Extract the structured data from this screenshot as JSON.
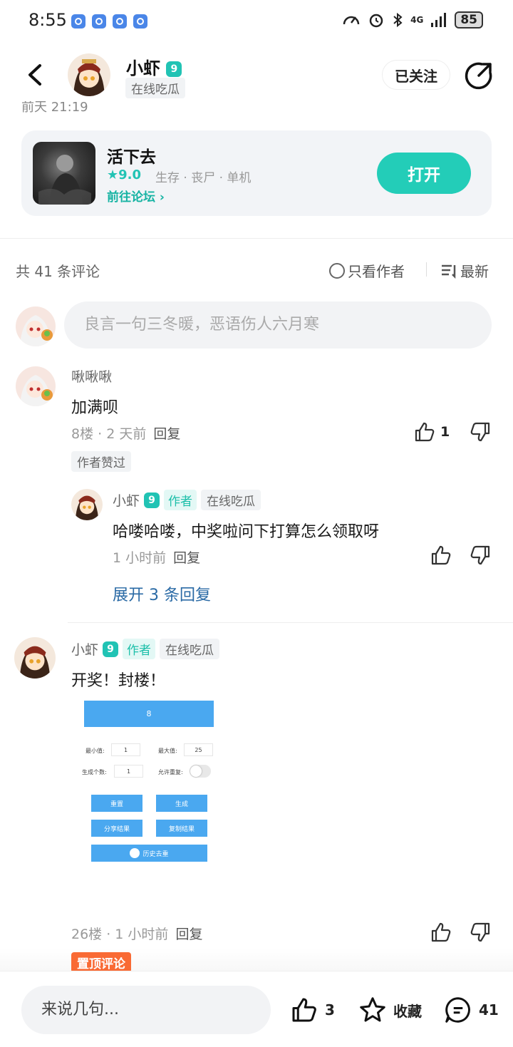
{
  "status_bar": {
    "time": "8:55",
    "signal": "4G",
    "battery": "85"
  },
  "header": {
    "author_name": "小虾",
    "level": "9",
    "author_tag": "在线吃瓜",
    "follow_label": "已关注",
    "post_time": "前天 21:19"
  },
  "game_card": {
    "title": "活下去",
    "rating": "9.0",
    "tags": "生存 · 丧尸 · 单机",
    "forum_link": "前往论坛",
    "open_label": "打开"
  },
  "comments_header": {
    "count": "共 41 条评论",
    "only_author": "只看作者",
    "sort": "最新"
  },
  "comment_input_placeholder": "良言一句三冬暖，恶语伤人六月寒",
  "comment1": {
    "name": "啾啾啾",
    "text": "加满呗",
    "floor_time": "8楼 · 2 天前",
    "reply_label": "回复",
    "likes": "1",
    "author_liked": "作者赞过",
    "reply": {
      "name": "小虾",
      "level": "9",
      "author_badge": "作者",
      "tag": "在线吃瓜",
      "text": "哈喽哈喽，中奖啦问下打算怎么领取呀",
      "time": "1 小时前",
      "reply_label": "回复"
    },
    "expand": "展开 3 条回复"
  },
  "comment2": {
    "name": "小虾",
    "level": "9",
    "author_badge": "作者",
    "tag": "在线吃瓜",
    "text": "开奖！封楼！",
    "floor_time": "26楼 · 1 小时前",
    "reply_label": "回复",
    "pinned": "置顶评论",
    "image": {
      "result": "8",
      "min_label": "最小值:",
      "min_value": "1",
      "max_label": "最大值:",
      "max_value": "25",
      "count_label": "生成个数:",
      "count_value": "1",
      "repeat_label": "允许重复:",
      "reset": "重置",
      "generate": "生成",
      "share": "分享结果",
      "copy": "复制结果",
      "history": "历史去重"
    }
  },
  "bottom_bar": {
    "input_placeholder": "来说几句...",
    "likes": "3",
    "favorite": "收藏",
    "comments": "41"
  },
  "colors": {
    "accent": "#23cdb8",
    "link": "#2a6aa5",
    "pinned": "#f96a34"
  }
}
